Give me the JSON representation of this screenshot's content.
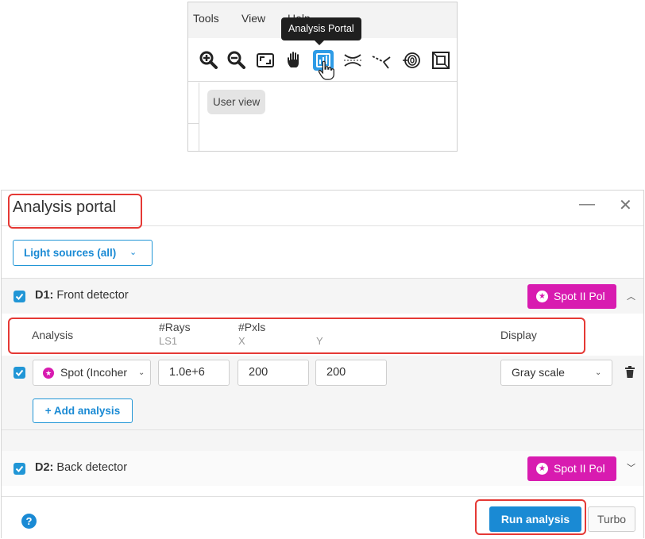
{
  "menu": {
    "tools": "Tools",
    "view": "View",
    "help": "Help"
  },
  "tooltip": "Analysis Portal",
  "toolbar_icons": [
    "zoom-in-icon",
    "zoom-out-icon",
    "fit-view-icon",
    "pan-hand-icon",
    "analysis-portal-icon",
    "lens-icon",
    "ray-icon",
    "spiral-icon",
    "frame-icon"
  ],
  "user_view": "User view",
  "portal": {
    "title": "Analysis portal",
    "minimize": "—",
    "close": "✕",
    "light_sources": "Light sources (all)",
    "d1": {
      "id": "D1:",
      "name": "Front detector",
      "tag": "Spot II Pol"
    },
    "d2": {
      "id": "D2:",
      "name": "Back detector",
      "tag": "Spot II Pol"
    },
    "headers": {
      "analysis": "Analysis",
      "rays": "#Rays",
      "rays_sub": "LS1",
      "pxls": "#Pxls",
      "pxls_x": "X",
      "pxls_y": "Y",
      "display": "Display"
    },
    "row": {
      "analysis": "Spot (Incoher",
      "rays": "1.0e+6",
      "x": "200",
      "y": "200",
      "display": "Gray scale"
    },
    "add_analysis": "+ Add analysis",
    "help": "?",
    "run": "Run analysis",
    "turbo": "Turbo"
  },
  "colors": {
    "accent": "#1a8ad4",
    "spot_tag": "#d81bb0",
    "annotation": "#e53935"
  }
}
